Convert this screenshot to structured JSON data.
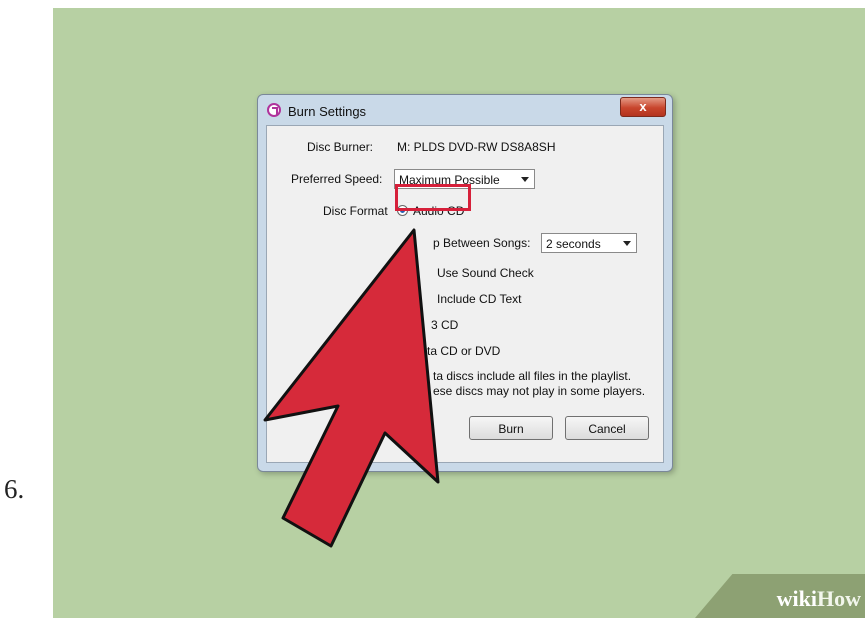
{
  "step_number": "6.",
  "dialog": {
    "title": "Burn Settings",
    "close_label": "x",
    "disc_burner_label": "Disc Burner:",
    "disc_burner_value": "M: PLDS DVD-RW DS8A8SH",
    "preferred_speed_label": "Preferred Speed:",
    "preferred_speed_value": "Maximum Possible",
    "disc_format_label": "Disc Format",
    "audio_cd_label": "Audio CD",
    "gap_label": "p Between Songs:",
    "gap_value": "2 seconds",
    "sound_check_label": "Use Sound Check",
    "cd_text_label": "Include CD Text",
    "mp3_cd_label": "3 CD",
    "data_cd_label": "ta CD or DVD",
    "note_line1": "ta discs include all files in the playlist.",
    "note_line2": "ese discs may not play in some players.",
    "burn_label": "Burn",
    "cancel_label": "Cancel"
  },
  "watermark": {
    "wiki": "wiki",
    "how": "How"
  },
  "colors": {
    "background": "#b7d0a3",
    "arrow": "#d62a3a",
    "highlight": "#d6203a"
  }
}
